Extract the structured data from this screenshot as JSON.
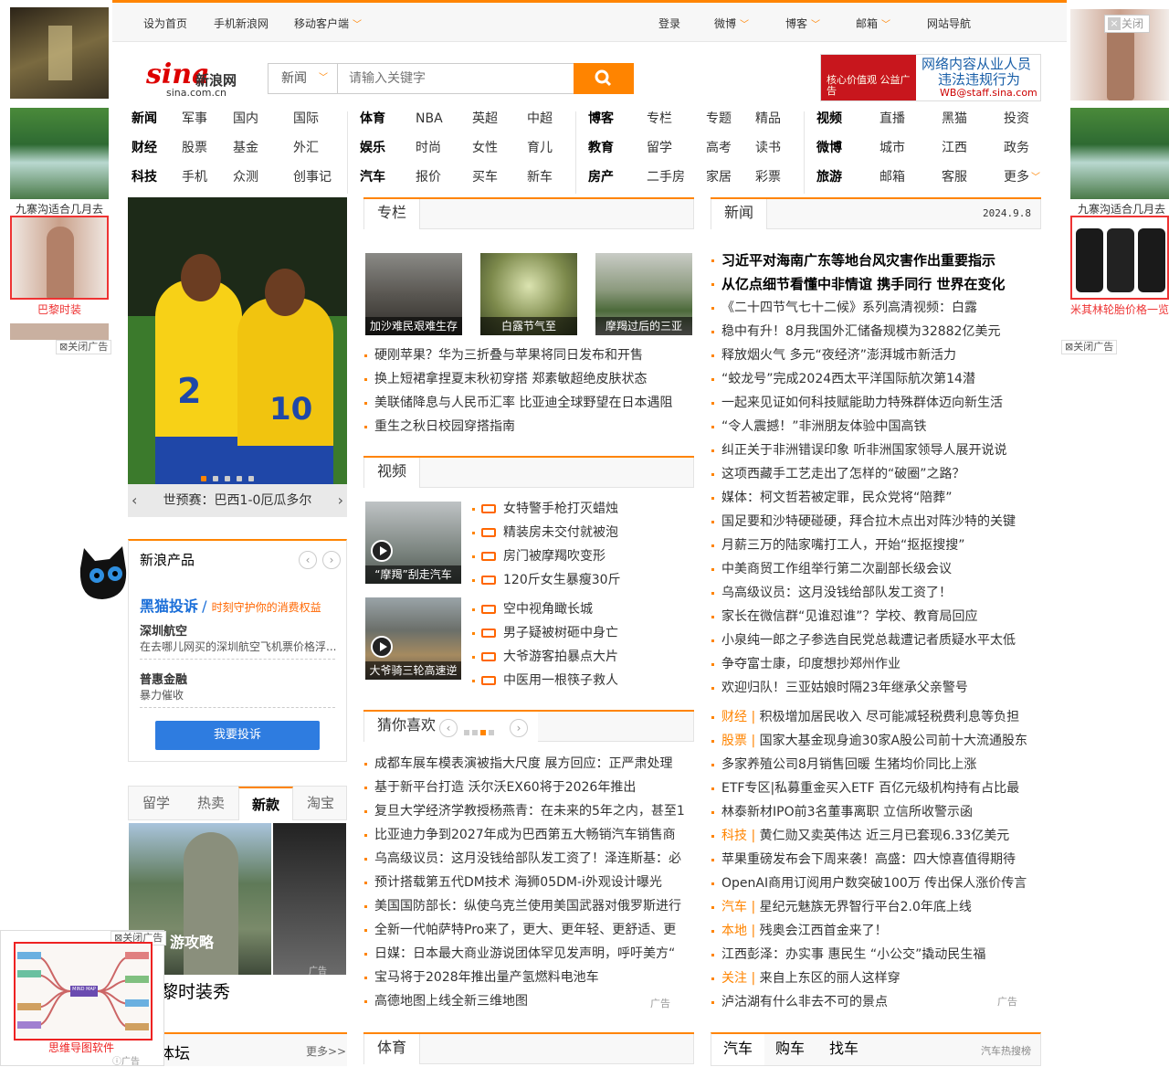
{
  "topbar": {
    "home": "设为首页",
    "mobile": "手机新浪网",
    "client": "移动客户端",
    "login": "登录",
    "weibo": "微博",
    "blog": "博客",
    "mail": "邮箱",
    "nav": "网站导航",
    "close": "关闭"
  },
  "logo": {
    "brand": "sina",
    "cn": "新浪网",
    "domain": "sina.com.cn"
  },
  "search": {
    "category": "新闻",
    "placeholder": "请输入关键字"
  },
  "header_ad": {
    "left": "核心价值观 公益广告",
    "title1": "网络内容从业人员",
    "title2": "违法违规行为",
    "email": "WB@staff.sina.com"
  },
  "nav": [
    [
      "新闻",
      "军事",
      "国内",
      "国际"
    ],
    [
      "财经",
      "股票",
      "基金",
      "外汇"
    ],
    [
      "科技",
      "手机",
      "众测",
      "创事记"
    ],
    [
      "体育",
      "NBA",
      "英超",
      "中超"
    ],
    [
      "娱乐",
      "时尚",
      "女性",
      "育儿"
    ],
    [
      "汽车",
      "报价",
      "买车",
      "新车"
    ],
    [
      "博客",
      "专栏",
      "专题",
      "精品"
    ],
    [
      "教育",
      "留学",
      "高考",
      "读书"
    ],
    [
      "房产",
      "二手房",
      "家居",
      "彩票"
    ],
    [
      "视频",
      "直播",
      "黑猫",
      "投资"
    ],
    [
      "微博",
      "城市",
      "江西",
      "政务"
    ],
    [
      "旅游",
      "邮箱",
      "客服",
      "更多"
    ]
  ],
  "hero": {
    "caption": "世预赛：巴西1-0厄瓜多尔",
    "num_left": "2",
    "num_right": "10"
  },
  "products": {
    "title": "新浪产品",
    "heimao": "黑猫投诉",
    "heimao_slogan": "时刻守护你的消费权益",
    "item1_t": "深圳航空",
    "item1_d": "在去哪儿网买的深圳航空飞机票价格浮...",
    "item2_t": "普惠金融",
    "item2_d": "暴力催收",
    "button": "我要投诉"
  },
  "tabs": [
    "留学",
    "热卖",
    "新款",
    "淘宝"
  ],
  "tab_content": {
    "overlay": "游攻略",
    "caption": "黎时装秀",
    "ad": "广告"
  },
  "bottom_left": {
    "title": "体坛",
    "more": "更多>>"
  },
  "zhuanlan": {
    "title": "专栏",
    "thumbs": [
      "加沙难民艰难生存",
      "白露节气至",
      "摩羯过后的三亚"
    ],
    "items": [
      "硬刚苹果？华为三折叠与苹果将同日发布和开售",
      "换上短裙拿捏夏末秋初穿搭 郑素敏超绝皮肤状态",
      "美联储降息与人民币汇率 比亚迪全球野望在日本遇阻",
      "重生之秋日校园穿搭指南"
    ]
  },
  "video": {
    "title": "视频",
    "thumbs": [
      "“摩羯”刮走汽车",
      "大爷骑三轮高速逆"
    ],
    "items": [
      "女特警手枪打灭蜡烛",
      "精装房未交付就被泡",
      "房门被摩羯吹变形",
      "120斤女生暴瘦30斤",
      "空中视角瞰长城",
      "男子疑被树砸中身亡",
      "大爷游客拍暴点大片",
      "中医用一根筷子救人"
    ]
  },
  "guess": {
    "title": "猜你喜欢",
    "items": [
      "成都车展车模表演被指大尺度 展方回应：正严肃处理",
      "基于新平台打造 沃尔沃EX60将于2026年推出",
      "复旦大学经济学教授杨燕青：在未来的5年之内，甚至1",
      "比亚迪力争到2027年成为巴西第五大畅销汽车销售商",
      "乌高级议员：这月没钱给部队发工资了！泽连斯基：必",
      "预计搭载第五代DM技术 海狮05DM-i外观设计曝光",
      "美国国防部长：纵使乌克兰使用美国武器对俄罗斯进行",
      "全新一代帕萨特Pro来了，更大、更年轻、更舒适、更",
      "日媒：日本最大商业游说团体罕见发声明，呼吁美方“",
      "宝马将于2028年推出量产氢燃料电池车",
      "高德地图上线全新三维地图"
    ],
    "ad": "广告"
  },
  "sports": {
    "title": "体育"
  },
  "news": {
    "title": "新闻",
    "date": "2024.9.8",
    "headlines": [
      "习近平对海南广东等地台风灾害作出重要指示",
      "从亿点细节看懂中非情谊 携手同行 世界在变化"
    ],
    "items": [
      "《二十四节气七十二候》系列高清视频：白露",
      "稳中有升！8月我国外汇储备规模为32882亿美元",
      "释放烟火气 多元“夜经济”澎湃城市新活力",
      "“蛟龙号”完成2024西太平洋国际航次第14潜",
      "一起来见证如何科技赋能助力特殊群体迈向新生活",
      "“令人震撼！”非洲朋友体验中国高铁",
      "纠正关于非洲错误印象 听非洲国家领导人展开说说",
      "这项西藏手工艺走出了怎样的“破圈”之路？",
      "媒体：柯文哲若被定罪，民众党将“陪葬”",
      "国足要和沙特硬碰硬，拜合拉木点出对阵沙特的关键",
      "月薪三万的陆家嘴打工人，开始“抠抠搜搜”",
      "中美商贸工作组举行第二次副部长级会议",
      "乌高级议员：这月没钱给部队发工资了！",
      "家长在微信群“见谁怼谁”？学校、教育局回应",
      "小泉纯一郎之子参选自民党总裁遭记者质疑水平太低",
      "争夺富士康，印度想抄郑州作业",
      "欢迎归队！三亚姑娘时隔23年继承父亲警号"
    ],
    "tagged": [
      [
        "财经",
        "积极增加居民收入 尽可能减轻税费利息等负担"
      ],
      [
        "股票",
        "国家大基金现身逾30家A股公司前十大流通股东"
      ],
      [
        "",
        "多家养殖公司8月销售回暖 生猪均价同比上涨"
      ],
      [
        "",
        "ETF专区|私募重金买入ETF 百亿元级机构持有占比最"
      ],
      [
        "",
        "林泰新材IPO前3名董事离职 立信所收警示函"
      ],
      [
        "科技",
        "黄仁勋又卖英伟达 近三月已套现6.33亿美元"
      ],
      [
        "",
        "苹果重磅发布会下周来袭！高盛：四大惊喜值得期待"
      ],
      [
        "",
        "OpenAI商用订阅用户数突破100万 传出保人涨价传言"
      ],
      [
        "汽车",
        "星纪元魅族无界智行平台2.0年底上线"
      ],
      [
        "本地",
        "残奥会江西首金来了！"
      ],
      [
        "",
        "江西彭泽：办实事 惠民生 “小公交”撬动民生福"
      ],
      [
        "关注",
        "来自上东区的丽人这样穿"
      ],
      [
        "",
        "泸沽湖有什么非去不可的景点"
      ]
    ],
    "ad": "广告"
  },
  "auto": {
    "tabs": [
      "汽车",
      "购车",
      "找车"
    ],
    "right": "汽车热搜榜"
  },
  "left_ads": {
    "cap1": "九寨沟适合几月去",
    "cap2": "巴黎时装",
    "close": "关闭广告"
  },
  "right_ads": {
    "cap1": "九寨沟适合几月去",
    "cap2": "米其林轮胎价格一览",
    "close": "关闭广告"
  },
  "float_ad": {
    "close": "关闭广告",
    "caption": "思维导图软件",
    "ad": "广告",
    "center": "MIND MAP"
  }
}
